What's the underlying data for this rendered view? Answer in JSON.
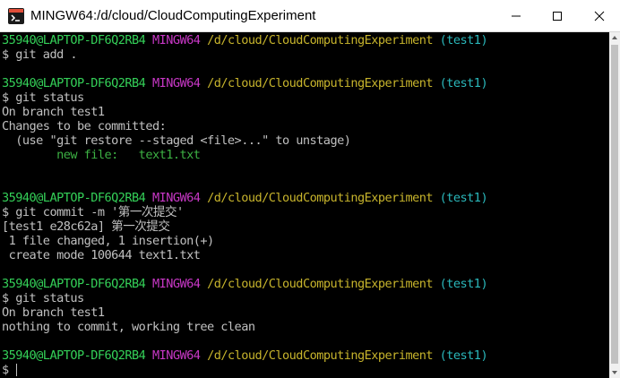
{
  "window": {
    "title": "MINGW64:/d/cloud/CloudComputingExperiment"
  },
  "icons": {
    "app": "git-bash-icon",
    "minimize": "minimize-icon",
    "maximize": "maximize-icon",
    "close": "close-icon"
  },
  "colors": {
    "user": "#34d058",
    "mingw": "#c838c6",
    "path": "#c7b42c",
    "branch": "#2ab7ba",
    "text": "#c0c0c0",
    "background": "#000000"
  },
  "prompt": {
    "user": "35940@LAPTOP-DF6Q2RB4",
    "env": "MINGW64",
    "path": "/d/cloud/CloudComputingExperiment",
    "branch": "(test1)"
  },
  "terminal": {
    "cmd1": "$ git add .",
    "cmd2": "$ git status",
    "status1_l1": "On branch test1",
    "status1_l2": "Changes to be committed:",
    "status1_l3": "  (use \"git restore --staged <file>...\" to unstage)",
    "status1_l4": "        new file:   text1.txt",
    "cmd3": "$ git commit -m '第一次提交'",
    "commit_l1": "[test1 e28c62a] 第一次提交",
    "commit_l2": " 1 file changed, 1 insertion(+)",
    "commit_l3": " create mode 100644 text1.txt",
    "cmd4": "$ git status",
    "status2_l1": "On branch test1",
    "status2_l2": "nothing to commit, working tree clean",
    "cmd5": "$ "
  }
}
